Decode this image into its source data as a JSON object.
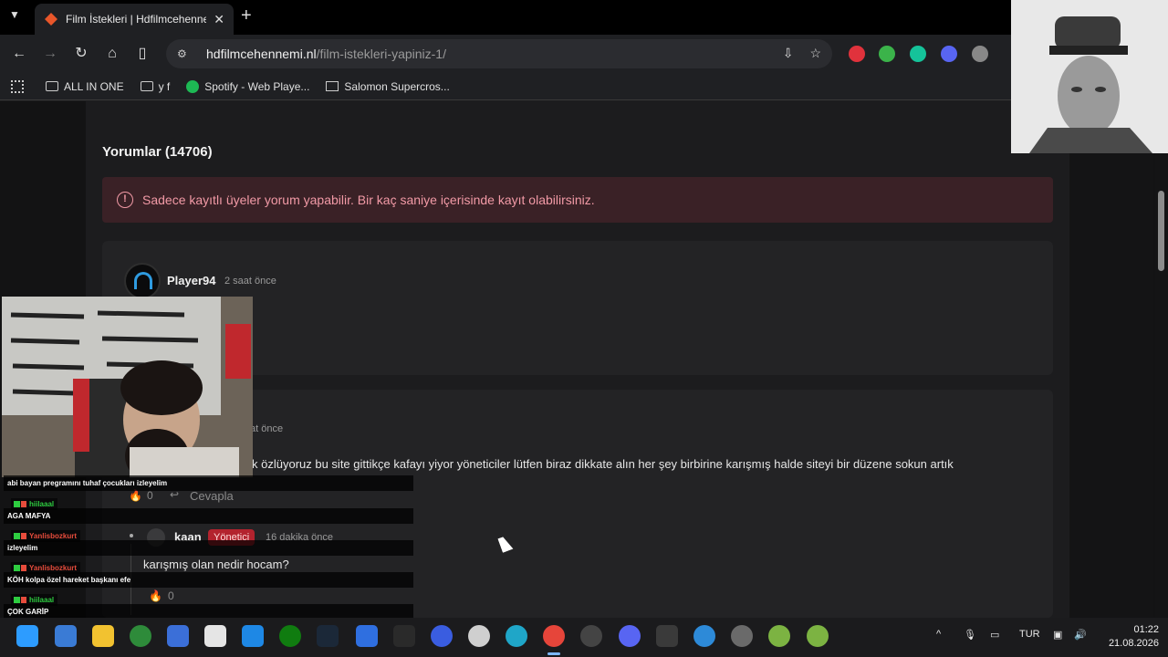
{
  "browser": {
    "tab": {
      "title": "Film İstekleri | Hdfilmcehennemi"
    },
    "url": {
      "host": "hdfilmcehennemi.nl",
      "path": "/film-istekleri-yapiniz-1/"
    },
    "bookmarks": [
      {
        "label": "ALL IN ONE",
        "icon": "folder-icon"
      },
      {
        "label": "y f",
        "icon": "folder-icon"
      },
      {
        "label": "Spotify - Web Playe...",
        "icon": "spotify-icon"
      },
      {
        "label": "Salomon Supercros...",
        "icon": "page-icon"
      }
    ]
  },
  "page": {
    "comments_heading": "Yorumlar (14706)",
    "alert": "Sadece kayıtlı üyeler yorum yapabilir. Bir kaç saniye içerisinde kayıt olabilirsiniz.",
    "comments": [
      {
        "user": "Player94",
        "time": "2 saat önce"
      },
      {
        "time_partial": "at önce",
        "text_partial": "k özlüyoruz bu site gittikçe kafayı yiyor yöneticiler lütfen biraz dikkate alın her şey birbirine karışmış halde siteyi bir düzene sokun artık",
        "likes": "0",
        "reply_label": "Cevapla"
      }
    ],
    "reply": {
      "user": "kaan",
      "badge": "Yönetici",
      "time": "16 dakika önce",
      "text": "karışmış olan nedir hocam?",
      "likes": "0"
    }
  },
  "chat": [
    {
      "message": "abi bayan pregramını tuhaf çocukları izleyelim"
    },
    {
      "user": "hiilaaal",
      "user_color": "#2ecc40",
      "message": "AGA MAFYA"
    },
    {
      "user": "Yanlisbozkurt",
      "user_color": "#e74c3c",
      "message": "izleyelim"
    },
    {
      "user": "Yanlisbozkurt",
      "user_color": "#e74c3c",
      "message": "KÖH kolpa özel hareket başkanı efe"
    },
    {
      "user": "hiilaaal",
      "user_color": "#2ecc40",
      "message": "ÇOK GARİP"
    }
  ],
  "taskbar": {
    "language": "TUR",
    "time": "01:22",
    "date": "21.08.2026"
  },
  "colors": {
    "accent": "#2f9be0",
    "alert_bg": "#3a2126",
    "alert_text": "#f29aa6",
    "badge": "#b3232e"
  }
}
